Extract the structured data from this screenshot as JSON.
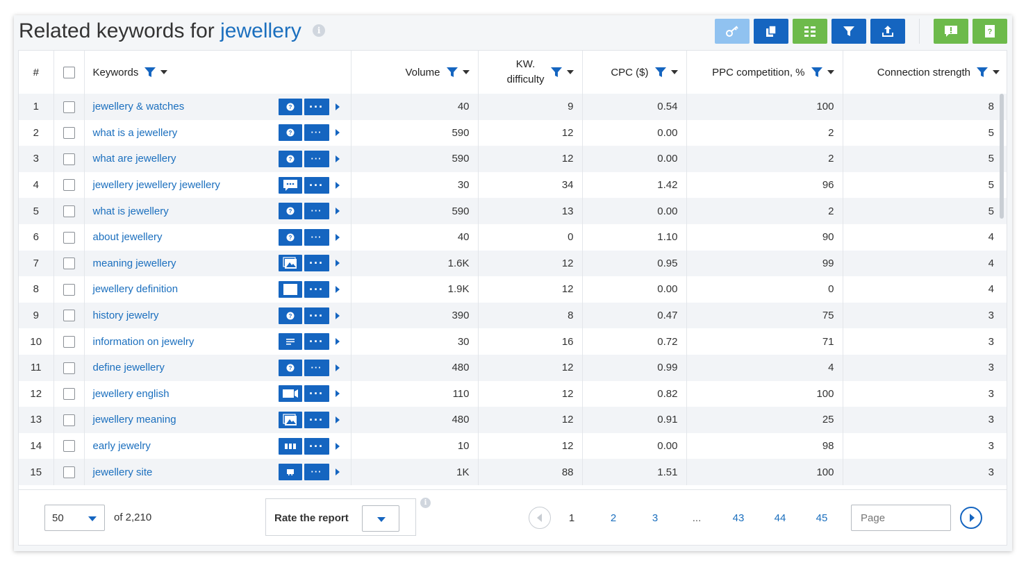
{
  "header": {
    "title_prefix": "Related keywords for",
    "title_keyword": "jewellery"
  },
  "toolbar": {
    "buttons": [
      {
        "name": "key-icon",
        "color": "#90c2f0"
      },
      {
        "name": "copy-icon",
        "color": "#1565c0"
      },
      {
        "name": "columns-icon",
        "color": "#6dba4b"
      },
      {
        "name": "filter-icon",
        "color": "#1565c0"
      },
      {
        "name": "export-icon",
        "color": "#1565c0"
      },
      {
        "name": "feedback-icon",
        "color": "#6dba4b"
      },
      {
        "name": "help-icon",
        "color": "#6dba4b"
      }
    ]
  },
  "table": {
    "columns": {
      "num": "#",
      "keywords": "Keywords",
      "volume": "Volume",
      "difficulty_line1": "KW.",
      "difficulty_line2": "difficulty",
      "cpc": "CPC ($)",
      "ppc": "PPC competition, %",
      "strength": "Connection strength"
    },
    "rows": [
      {
        "n": "1",
        "keyword": "jewellery & watches",
        "serp": "question-icon",
        "volume": "40",
        "difficulty": "9",
        "cpc": "0.54",
        "ppc": "100",
        "strength": "8"
      },
      {
        "n": "2",
        "keyword": "what is a jewellery",
        "serp": "question-icon",
        "volume": "590",
        "difficulty": "12",
        "cpc": "0.00",
        "ppc": "2",
        "strength": "5"
      },
      {
        "n": "3",
        "keyword": "what are jewellery",
        "serp": "question-icon",
        "volume": "590",
        "difficulty": "12",
        "cpc": "0.00",
        "ppc": "2",
        "strength": "5"
      },
      {
        "n": "4",
        "keyword": "jewellery jewellery jewellery",
        "serp": "comment-icon",
        "volume": "30",
        "difficulty": "34",
        "cpc": "1.42",
        "ppc": "96",
        "strength": "5"
      },
      {
        "n": "5",
        "keyword": "what is jewellery",
        "serp": "question-icon",
        "volume": "590",
        "difficulty": "13",
        "cpc": "0.00",
        "ppc": "2",
        "strength": "5"
      },
      {
        "n": "6",
        "keyword": "about jewellery",
        "serp": "question-icon",
        "volume": "40",
        "difficulty": "0",
        "cpc": "1.10",
        "ppc": "90",
        "strength": "4"
      },
      {
        "n": "7",
        "keyword": "meaning jewellery",
        "serp": "images-icon",
        "volume": "1.6K",
        "difficulty": "12",
        "cpc": "0.95",
        "ppc": "99",
        "strength": "4"
      },
      {
        "n": "8",
        "keyword": "jewellery definition",
        "serp": "blank-card-icon",
        "volume": "1.9K",
        "difficulty": "12",
        "cpc": "0.00",
        "ppc": "0",
        "strength": "4"
      },
      {
        "n": "9",
        "keyword": "history jewelry",
        "serp": "question-icon",
        "volume": "390",
        "difficulty": "8",
        "cpc": "0.47",
        "ppc": "75",
        "strength": "3"
      },
      {
        "n": "10",
        "keyword": "information on jewelry",
        "serp": "snippet-icon",
        "volume": "30",
        "difficulty": "16",
        "cpc": "0.72",
        "ppc": "71",
        "strength": "3"
      },
      {
        "n": "11",
        "keyword": "define jewellery",
        "serp": "question-icon",
        "volume": "480",
        "difficulty": "12",
        "cpc": "0.99",
        "ppc": "4",
        "strength": "3"
      },
      {
        "n": "12",
        "keyword": "jewellery english",
        "serp": "video-icon",
        "volume": "110",
        "difficulty": "12",
        "cpc": "0.82",
        "ppc": "100",
        "strength": "3"
      },
      {
        "n": "13",
        "keyword": "jewellery meaning",
        "serp": "images-icon",
        "volume": "480",
        "difficulty": "12",
        "cpc": "0.91",
        "ppc": "25",
        "strength": "3"
      },
      {
        "n": "14",
        "keyword": "early jewelry",
        "serp": "carousel-icon",
        "volume": "10",
        "difficulty": "12",
        "cpc": "0.00",
        "ppc": "98",
        "strength": "3"
      },
      {
        "n": "15",
        "keyword": "jewellery site",
        "serp": "shop-icon",
        "volume": "1K",
        "difficulty": "88",
        "cpc": "1.51",
        "ppc": "100",
        "strength": "3"
      }
    ]
  },
  "footer": {
    "per_page": "50",
    "of_total": "of 2,210",
    "rate_label": "Rate the report",
    "pages": [
      "1",
      "2",
      "3",
      "...",
      "43",
      "44",
      "45"
    ],
    "current_page": "1",
    "page_placeholder": "Page"
  }
}
